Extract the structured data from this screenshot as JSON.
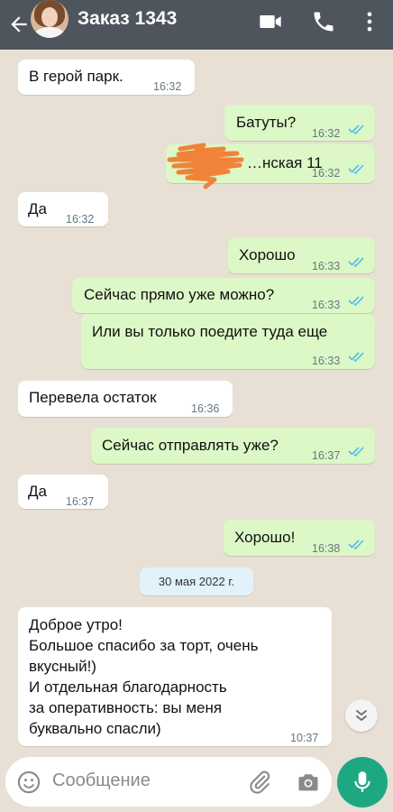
{
  "header": {
    "title": "Заказ 1343"
  },
  "messages": [
    {
      "dir": "in",
      "text": "В герой парк.",
      "time": "16:32"
    },
    {
      "dir": "out",
      "text": "Батуты?",
      "time": "16:32"
    },
    {
      "dir": "out",
      "text": "…нская 11",
      "time": "16:32"
    },
    {
      "dir": "in",
      "text": "Да",
      "time": "16:32"
    },
    {
      "dir": "out",
      "text": "Хорошо",
      "time": "16:33"
    },
    {
      "dir": "out",
      "text": "Сейчас прямо уже можно?",
      "time": "16:33"
    },
    {
      "dir": "out",
      "text": "Или вы только поедите туда еще",
      "time": "16:33"
    },
    {
      "dir": "in",
      "text": "Перевела остаток",
      "time": "16:36"
    },
    {
      "dir": "out",
      "text": "Сейчас отправлять уже?",
      "time": "16:37"
    },
    {
      "dir": "in",
      "text": "Да",
      "time": "16:37"
    },
    {
      "dir": "out",
      "text": "Хорошо!",
      "time": "16:38"
    },
    {
      "dir": "in",
      "lines": [
        "Доброе утро!",
        "Большое спасибо за торт, очень",
        "вкусный!)",
        "И отдельная благодарность",
        "за оперативность: вы меня",
        "буквально спасли)"
      ],
      "time": "10:37"
    }
  ],
  "date_separator": "30 мая 2022 г.",
  "composer": {
    "placeholder": "Сообщение"
  },
  "colors": {
    "header": "#4e555d",
    "incoming": "#ffffff",
    "outgoing": "#dcf8c6",
    "accent": "#1ea882",
    "read_tick": "#53bdeb"
  },
  "icons": [
    "back-arrow-icon",
    "video-call-icon",
    "phone-icon",
    "more-vert-icon",
    "read-ticks-icon",
    "emoji-icon",
    "attach-icon",
    "camera-icon",
    "mic-icon",
    "chevron-down-icon"
  ]
}
